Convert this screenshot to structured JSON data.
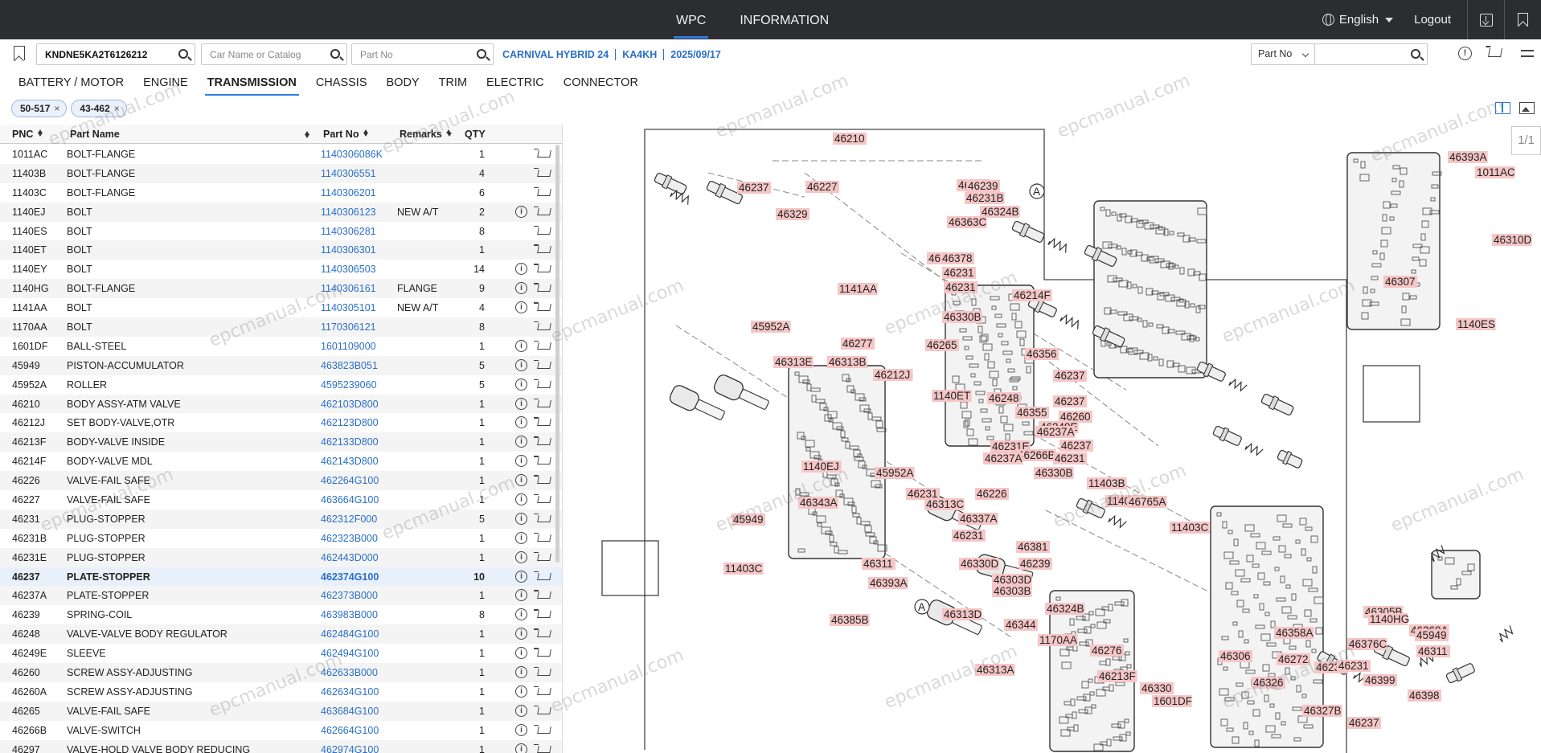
{
  "topnav": {
    "tabs": [
      {
        "label": "WPC",
        "active": true
      },
      {
        "label": "INFORMATION",
        "active": false
      }
    ]
  },
  "topright": {
    "language": "English",
    "logout": "Logout",
    "icons": [
      "globe-icon",
      "caret-down-icon",
      "download-icon",
      "bookmark-icon"
    ]
  },
  "search": {
    "vin_value": "KNDNE5KA2T6126212",
    "car_placeholder": "Car Name or Catalog",
    "partno_placeholder": "Part No",
    "right_select": "Part No",
    "right_value": ""
  },
  "vehicle": {
    "model": "CARNIVAL HYBRID 24",
    "code": "KA4KH",
    "date": "2025/09/17"
  },
  "categories": [
    {
      "label": "BATTERY / MOTOR",
      "active": false
    },
    {
      "label": "ENGINE",
      "active": false
    },
    {
      "label": "TRANSMISSION",
      "active": true
    },
    {
      "label": "CHASSIS",
      "active": false
    },
    {
      "label": "BODY",
      "active": false
    },
    {
      "label": "TRIM",
      "active": false
    },
    {
      "label": "ELECTRIC",
      "active": false
    },
    {
      "label": "CONNECTOR",
      "active": false
    }
  ],
  "chips": [
    {
      "label": "50-517",
      "close": "×"
    },
    {
      "label": "43-462",
      "close": "×"
    }
  ],
  "table": {
    "headers": {
      "pnc": "PNC",
      "name": "Part Name",
      "no": "Part No",
      "remarks": "Remarks",
      "qty": "QTY"
    },
    "rows": [
      {
        "pnc": "1011AC",
        "name": "BOLT-FLANGE",
        "no": "1140306086K",
        "rm": "",
        "qty": "1",
        "info": false
      },
      {
        "pnc": "11403B",
        "name": "BOLT-FLANGE",
        "no": "1140306551",
        "rm": "",
        "qty": "4",
        "info": false
      },
      {
        "pnc": "11403C",
        "name": "BOLT-FLANGE",
        "no": "1140306201",
        "rm": "",
        "qty": "6",
        "info": false
      },
      {
        "pnc": "1140EJ",
        "name": "BOLT",
        "no": "1140306123",
        "rm": "NEW A/T",
        "qty": "2",
        "info": true
      },
      {
        "pnc": "1140ES",
        "name": "BOLT",
        "no": "1140306281",
        "rm": "",
        "qty": "8",
        "info": false
      },
      {
        "pnc": "1140ET",
        "name": "BOLT",
        "no": "1140306301",
        "rm": "",
        "qty": "1",
        "info": false
      },
      {
        "pnc": "1140EY",
        "name": "BOLT",
        "no": "1140306503",
        "rm": "",
        "qty": "14",
        "info": true
      },
      {
        "pnc": "1140HG",
        "name": "BOLT-FLANGE",
        "no": "1140306161",
        "rm": "FLANGE",
        "qty": "9",
        "info": true
      },
      {
        "pnc": "1141AA",
        "name": "BOLT",
        "no": "1140305101",
        "rm": "NEW A/T",
        "qty": "4",
        "info": true
      },
      {
        "pnc": "1170AA",
        "name": "BOLT",
        "no": "1170306121",
        "rm": "",
        "qty": "8",
        "info": false
      },
      {
        "pnc": "1601DF",
        "name": "BALL-STEEL",
        "no": "1601109000",
        "rm": "",
        "qty": "1",
        "info": true
      },
      {
        "pnc": "45949",
        "name": "PISTON-ACCUMULATOR",
        "no": "463823B051",
        "rm": "",
        "qty": "5",
        "info": true
      },
      {
        "pnc": "45952A",
        "name": "ROLLER",
        "no": "4595239060",
        "rm": "",
        "qty": "5",
        "info": true
      },
      {
        "pnc": "46210",
        "name": "BODY ASSY-ATM VALVE",
        "no": "462103D800",
        "rm": "",
        "qty": "1",
        "info": true
      },
      {
        "pnc": "46212J",
        "name": "SET BODY-VALVE,OTR",
        "no": "462123D800",
        "rm": "",
        "qty": "1",
        "info": true
      },
      {
        "pnc": "46213F",
        "name": "BODY-VALVE INSIDE",
        "no": "462133D800",
        "rm": "",
        "qty": "1",
        "info": true
      },
      {
        "pnc": "46214F",
        "name": "BODY-VALVE MDL",
        "no": "462143D800",
        "rm": "",
        "qty": "1",
        "info": true
      },
      {
        "pnc": "46226",
        "name": "VALVE-FAIL SAFE",
        "no": "462264G100",
        "rm": "",
        "qty": "1",
        "info": true
      },
      {
        "pnc": "46227",
        "name": "VALVE-FAIL SAFE",
        "no": "463664G100",
        "rm": "",
        "qty": "1",
        "info": true
      },
      {
        "pnc": "46231",
        "name": "PLUG-STOPPER",
        "no": "462312F000",
        "rm": "",
        "qty": "5",
        "info": true
      },
      {
        "pnc": "46231B",
        "name": "PLUG-STOPPER",
        "no": "462323B000",
        "rm": "",
        "qty": "1",
        "info": true
      },
      {
        "pnc": "46231E",
        "name": "PLUG-STOPPER",
        "no": "462443D000",
        "rm": "",
        "qty": "1",
        "info": true
      },
      {
        "pnc": "46237",
        "name": "PLATE-STOPPER",
        "no": "462374G100",
        "rm": "",
        "qty": "10",
        "info": true,
        "selected": true
      },
      {
        "pnc": "46237A",
        "name": "PLATE-STOPPER",
        "no": "462373B000",
        "rm": "",
        "qty": "1",
        "info": true
      },
      {
        "pnc": "46239",
        "name": "SPRING-COIL",
        "no": "463983B000",
        "rm": "",
        "qty": "8",
        "info": true
      },
      {
        "pnc": "46248",
        "name": "VALVE-VALVE BODY REGULATOR",
        "no": "462484G100",
        "rm": "",
        "qty": "1",
        "info": true
      },
      {
        "pnc": "46249E",
        "name": "SLEEVE",
        "no": "462494G100",
        "rm": "",
        "qty": "1",
        "info": true
      },
      {
        "pnc": "46260",
        "name": "SCREW ASSY-ADJUSTING",
        "no": "462633B000",
        "rm": "",
        "qty": "1",
        "info": true
      },
      {
        "pnc": "46260A",
        "name": "SCREW ASSY-ADJUSTING",
        "no": "462634G100",
        "rm": "",
        "qty": "1",
        "info": true
      },
      {
        "pnc": "46265",
        "name": "VALVE-FAIL SAFE",
        "no": "463684G100",
        "rm": "",
        "qty": "1",
        "info": true
      },
      {
        "pnc": "46266B",
        "name": "VALVE-SWITCH",
        "no": "462664G100",
        "rm": "",
        "qty": "1",
        "info": true
      },
      {
        "pnc": "46297",
        "name": "VALVE-HOLD VALVE BODY REDUCING",
        "no": "462974G100",
        "rm": "",
        "qty": "1",
        "info": true
      }
    ]
  },
  "diagram": {
    "page_indicator": "1/1",
    "labels": [
      "46210",
      "46237",
      "46227",
      "46329",
      "46237",
      "46231B",
      "46239",
      "46324B",
      "46363C",
      "46237",
      "46378",
      "46231",
      "46231",
      "1141AA",
      "46277",
      "46330B",
      "46265",
      "46214F",
      "45952A",
      "46313E",
      "46313B",
      "46212J",
      "1140ET",
      "46248",
      "46355",
      "46356",
      "46237",
      "46237",
      "46249E",
      "46260",
      "46237A",
      "46231E",
      "46266B",
      "46237",
      "46231",
      "46330B",
      "11403B",
      "1140EY",
      "46765A",
      "11403C",
      "1140EJ",
      "46343A",
      "45952A",
      "46313C",
      "46237A",
      "46231",
      "46226",
      "46337A",
      "46231",
      "46381",
      "46239",
      "46330D",
      "46303D",
      "46303B",
      "46324B",
      "45949",
      "46311",
      "46393A",
      "11403C",
      "46385B",
      "46313D",
      "46344",
      "1170AA",
      "46313A",
      "46276",
      "46213F",
      "46330",
      "1601DF",
      "46306",
      "46326",
      "46272",
      "46358A",
      "46376C",
      "46305B",
      "46237",
      "46231",
      "46399",
      "46398",
      "46327B",
      "46237",
      "46260A",
      "45949",
      "46311",
      "46393A",
      "1011AC",
      "46310D",
      "46307",
      "1140ES",
      "1140HG"
    ],
    "callouts": [
      "A",
      "A"
    ],
    "watermark": "epcmanual.com"
  }
}
